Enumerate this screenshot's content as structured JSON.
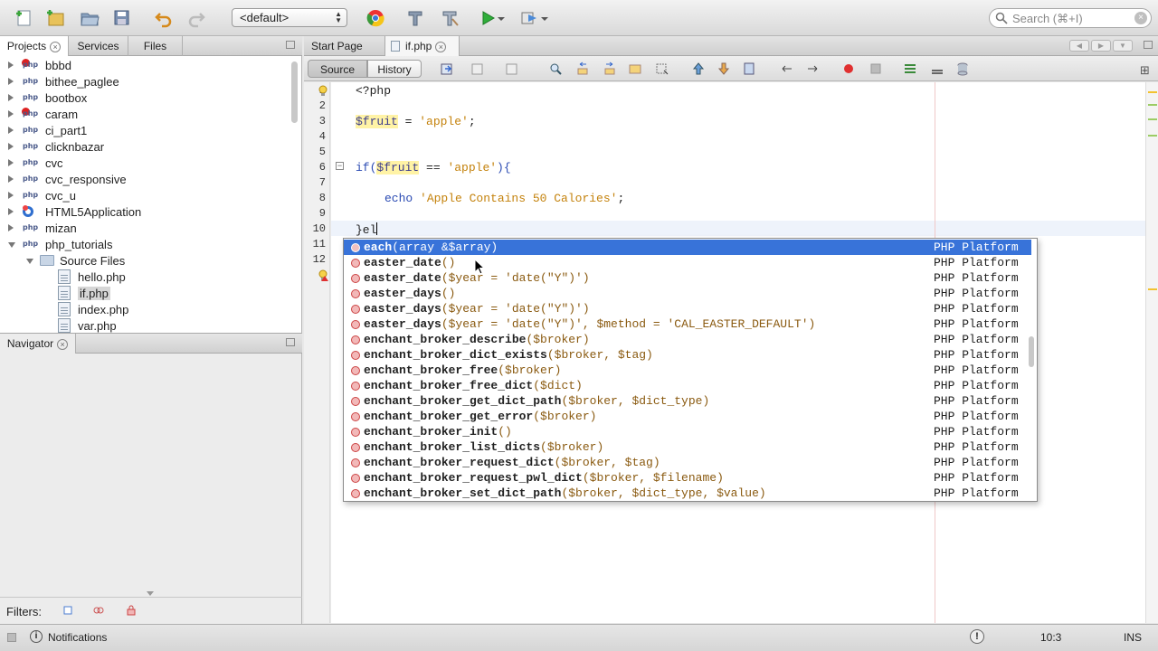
{
  "toolbar": {
    "config_value": "<default>",
    "search_placeholder": "Search (⌘+I)"
  },
  "projects_pane": {
    "tabs": [
      {
        "label": "Projects",
        "active": true,
        "closable": true
      },
      {
        "label": "Services",
        "active": false,
        "closable": false
      },
      {
        "label": "Files",
        "active": false,
        "closable": false
      }
    ],
    "tree": [
      {
        "label": "bbbd",
        "icon": "php-error-icon",
        "level": 0,
        "expanded": false
      },
      {
        "label": "bithee_paglee",
        "icon": "php-project-icon",
        "level": 0,
        "expanded": false
      },
      {
        "label": "bootbox",
        "icon": "php-project-icon",
        "level": 0,
        "expanded": false
      },
      {
        "label": "caram",
        "icon": "php-error-icon",
        "level": 0,
        "expanded": false
      },
      {
        "label": "ci_part1",
        "icon": "php-project-icon",
        "level": 0,
        "expanded": false
      },
      {
        "label": "clicknbazar",
        "icon": "php-project-icon",
        "level": 0,
        "expanded": false
      },
      {
        "label": "cvc",
        "icon": "php-project-icon",
        "level": 0,
        "expanded": false
      },
      {
        "label": "cvc_responsive",
        "icon": "php-project-icon",
        "level": 0,
        "expanded": false
      },
      {
        "label": "cvc_u",
        "icon": "php-project-icon",
        "level": 0,
        "expanded": false
      },
      {
        "label": "HTML5Application",
        "icon": "html5-project-icon",
        "level": 0,
        "expanded": false
      },
      {
        "label": "mizan",
        "icon": "php-project-icon",
        "level": 0,
        "expanded": false
      },
      {
        "label": "php_tutorials",
        "icon": "php-project-icon",
        "level": 0,
        "expanded": true
      },
      {
        "label": "Source Files",
        "icon": "folder-icon",
        "level": 1,
        "expanded": true
      },
      {
        "label": "hello.php",
        "icon": "php-file-icon",
        "level": 2
      },
      {
        "label": "if.php",
        "icon": "php-file-icon",
        "level": 2,
        "selected": true
      },
      {
        "label": "index.php",
        "icon": "php-file-icon",
        "level": 2
      },
      {
        "label": "var.php",
        "icon": "php-file-icon",
        "level": 2
      }
    ]
  },
  "navigator_pane": {
    "title": "Navigator",
    "filters_label": "Filters:"
  },
  "editor": {
    "tabs": [
      {
        "label": "Start Page",
        "active": false
      },
      {
        "label": "if.php",
        "active": true
      }
    ],
    "view_buttons": {
      "source": "Source",
      "history": "History"
    },
    "line_numbers": [
      "1",
      "2",
      "3",
      "4",
      "5",
      "6",
      "7",
      "8",
      "9",
      "10",
      "11",
      "12"
    ],
    "code": {
      "l1": "<?php",
      "l3_var": "$fruit",
      "l3_op": " = ",
      "l3_str": "'apple'",
      "l3_end": ";",
      "l6_a": "if(",
      "l6_var": "$fruit",
      "l6_op": " == ",
      "l6_str": "'apple'",
      "l6_end": "){",
      "l8_kw": "echo ",
      "l8_str": "'Apple Contains 50 Calories'",
      "l8_end": ";",
      "l10": "}el"
    }
  },
  "completion": {
    "items": [
      {
        "name": "each",
        "params": "(array &$array)",
        "source": "PHP Platform",
        "selected": true
      },
      {
        "name": "easter_date",
        "params": "()",
        "source": "PHP Platform"
      },
      {
        "name": "easter_date",
        "params": "($year = 'date(\"Y\")')",
        "source": "PHP Platform"
      },
      {
        "name": "easter_days",
        "params": "()",
        "source": "PHP Platform"
      },
      {
        "name": "easter_days",
        "params": "($year = 'date(\"Y\")')",
        "source": "PHP Platform"
      },
      {
        "name": "easter_days",
        "params": "($year = 'date(\"Y\")', $method = 'CAL_EASTER_DEFAULT')",
        "source": "PHP Platform"
      },
      {
        "name": "enchant_broker_describe",
        "params": "($broker)",
        "source": "PHP Platform"
      },
      {
        "name": "enchant_broker_dict_exists",
        "params": "($broker, $tag)",
        "source": "PHP Platform"
      },
      {
        "name": "enchant_broker_free",
        "params": "($broker)",
        "source": "PHP Platform"
      },
      {
        "name": "enchant_broker_free_dict",
        "params": "($dict)",
        "source": "PHP Platform"
      },
      {
        "name": "enchant_broker_get_dict_path",
        "params": "($broker, $dict_type)",
        "source": "PHP Platform"
      },
      {
        "name": "enchant_broker_get_error",
        "params": "($broker)",
        "source": "PHP Platform"
      },
      {
        "name": "enchant_broker_init",
        "params": "()",
        "source": "PHP Platform"
      },
      {
        "name": "enchant_broker_list_dicts",
        "params": "($broker)",
        "source": "PHP Platform"
      },
      {
        "name": "enchant_broker_request_dict",
        "params": "($broker, $tag)",
        "source": "PHP Platform"
      },
      {
        "name": "enchant_broker_request_pwl_dict",
        "params": "($broker, $filename)",
        "source": "PHP Platform"
      },
      {
        "name": "enchant_broker_set_dict_path",
        "params": "($broker, $dict_type, $value)",
        "source": "PHP Platform"
      }
    ]
  },
  "statusbar": {
    "notifications": "Notifications",
    "position": "10:3",
    "mode": "INS"
  },
  "colors": {
    "selection": "#3873d9",
    "string": "#c4820c",
    "keyword": "#2b4bb3",
    "variable_highlight": "#fff3a6"
  }
}
